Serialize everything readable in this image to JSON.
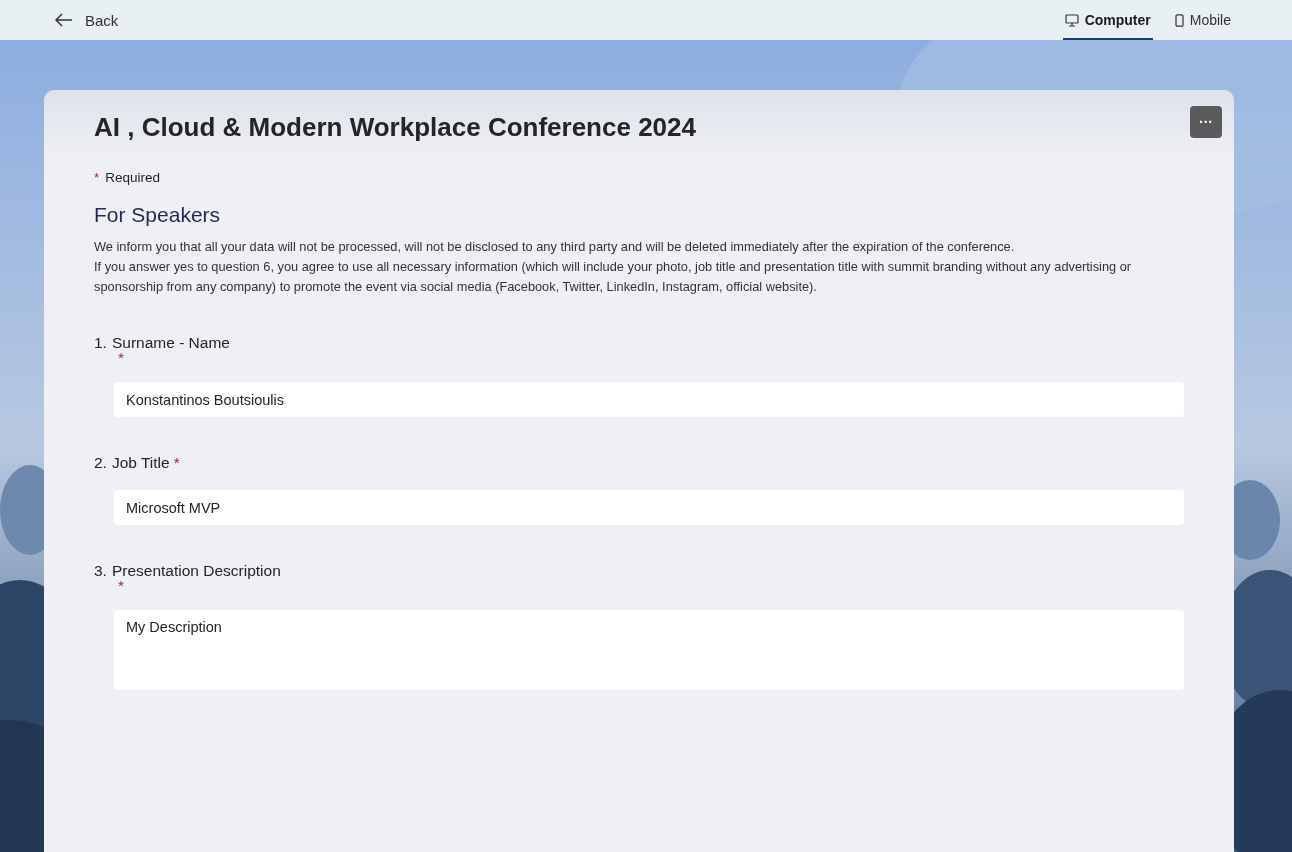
{
  "top_bar": {
    "back": "Back",
    "tabs": [
      {
        "label": "Computer",
        "selected": true
      },
      {
        "label": "Mobile",
        "selected": false
      }
    ]
  },
  "form": {
    "title": "AI , Cloud  & Modern Workplace Conference 2024",
    "more_button": "···",
    "required_note": {
      "star": "*",
      "label": "Required"
    },
    "section": {
      "title": "For Speakers",
      "paragraphs": [
        "We inform you that all your data will not be processed, will not be disclosed to any third party and will be deleted immediately after the expiration of the conference.",
        "If you answer yes to question  6, you agree to use all necessary information (which will include your photo, job title and presentation title with summit branding without any advertising or sponsorship from any company) to promote the event via social media (Facebook, Twitter, LinkedIn, Instagram, official website)."
      ]
    },
    "questions": [
      {
        "number": "1.",
        "label": "Surname - Name",
        "star": "*",
        "kind": "stacked",
        "multiline": false,
        "value": "Konstantinos Boutsioulis"
      },
      {
        "number": "2.",
        "label": "Job Title",
        "star": "*",
        "kind": "inline",
        "multiline": false,
        "value": "Microsoft MVP"
      },
      {
        "number": "3.",
        "label": "Presentation Description",
        "star": "*",
        "kind": "stacked",
        "multiline": true,
        "value": "My Description"
      }
    ]
  }
}
